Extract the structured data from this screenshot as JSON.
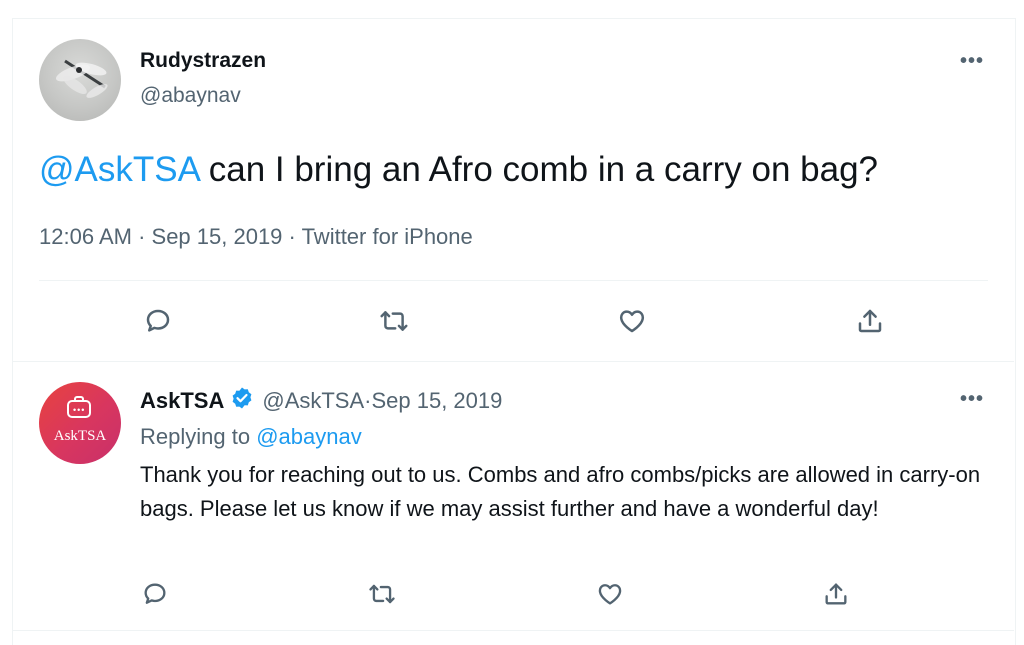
{
  "tweet": {
    "author_name": "Rudystrazen",
    "author_handle": "@abaynav",
    "mention": "@AskTSA",
    "text": " can I bring an Afro comb in a carry on bag?",
    "time": "12:06 AM",
    "date": "Sep 15, 2019",
    "source": "Twitter for iPhone",
    "sep": " · "
  },
  "reply": {
    "author_name": "AskTSA",
    "author_handle": "@AskTSA",
    "date": "Sep 15, 2019",
    "replying_label": "Replying to ",
    "replying_handle": "@abaynav",
    "text": "Thank you for reaching out to us. Combs and afro combs/picks are allowed in carry-on bags. Please let us know if we may assist further and have a wonderful day!",
    "avatar_text": "AskTSA"
  },
  "more_label": "•••",
  "colors": {
    "link": "#1d9bf0",
    "secondary": "#536471",
    "text": "#0f1419",
    "verified": "#1d9bf0"
  },
  "icons": [
    "comment-icon",
    "retweet-icon",
    "heart-icon",
    "share-icon",
    "verified-badge-icon",
    "more-icon"
  ]
}
